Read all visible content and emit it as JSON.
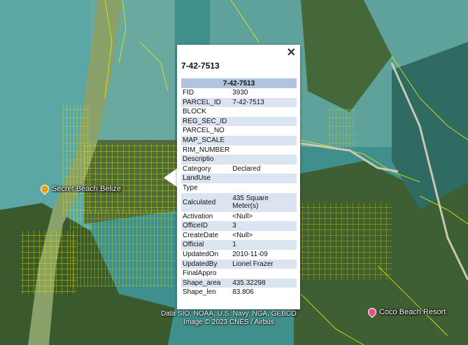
{
  "popup": {
    "title": "7-42-7513",
    "close_label": "✕",
    "header": "7-42-7513",
    "fields": [
      {
        "key": "FID",
        "value": "3930"
      },
      {
        "key": "PARCEL_ID",
        "value": "7-42-7513"
      },
      {
        "key": "BLOCK",
        "value": ""
      },
      {
        "key": "REG_SEC_ID",
        "value": ""
      },
      {
        "key": "PARCEL_NO",
        "value": ""
      },
      {
        "key": "MAP_SCALE",
        "value": ""
      },
      {
        "key": "RIM_NUMBER",
        "value": ""
      },
      {
        "key": "Descriptio",
        "value": ""
      },
      {
        "key": "Category",
        "value": "Declared"
      },
      {
        "key": "LandUse",
        "value": ""
      },
      {
        "key": "Type",
        "value": ""
      },
      {
        "key": "Calculated",
        "value": "435 Square Meter(s)"
      },
      {
        "key": "Activation",
        "value": "<Null>"
      },
      {
        "key": "OfficeID",
        "value": "3"
      },
      {
        "key": "CreateDate",
        "value": "<Null>"
      },
      {
        "key": "Official",
        "value": "1"
      },
      {
        "key": "UpdatedOn",
        "value": "2010-11-09"
      },
      {
        "key": "UpdatedBy",
        "value": "Lionel Frazer"
      },
      {
        "key": "FinalAppro",
        "value": ""
      },
      {
        "key": "Shape_area",
        "value": "435.32298"
      },
      {
        "key": "Shape_len",
        "value": "83.806"
      }
    ]
  },
  "map": {
    "places": [
      {
        "name": "Secret Beach Belize",
        "pin_color": "#f39c12"
      },
      {
        "name": "Coco Beach Resort",
        "pin_color": "#e84f8a"
      }
    ],
    "attribution_line1": "Data SIO, NOAA, U.S. Navy, NGA, GEBCO",
    "attribution_line2": "Image © 2023 CNES / Airbus",
    "parcel_color": "#e8f000"
  }
}
